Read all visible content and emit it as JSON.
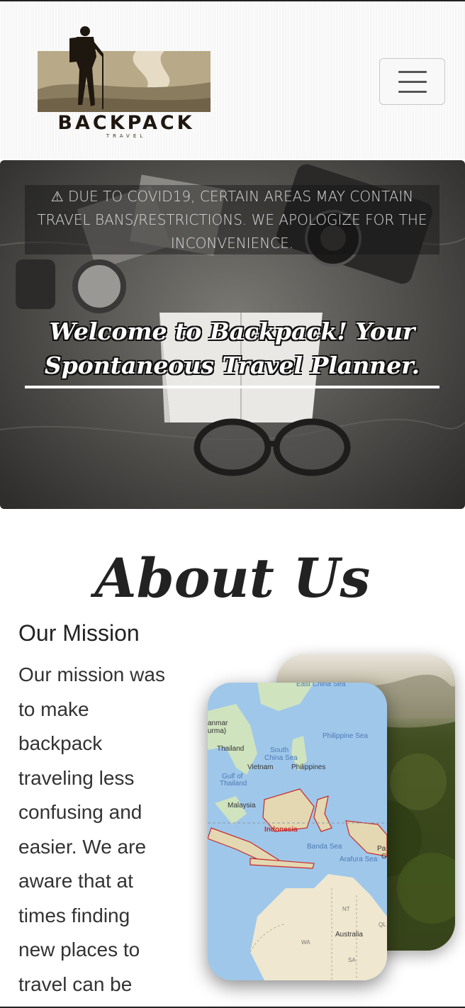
{
  "header": {
    "logo_text": "BACKPACK",
    "logo_subtext": "TRAVEL"
  },
  "hero": {
    "alert_icon": "⚠",
    "alert_text": "DUE TO COVID19, CERTAIN AREAS MAY CONTAIN TRAVEL BANS/RESTRICTIONS. WE APOLOGIZE FOR THE INCONVENIENCE.",
    "title_line1": "Welcome to Backpack! Your",
    "title_line2": "Spontaneous Travel Planner."
  },
  "about": {
    "title": "About Us",
    "mission_title": "Our Mission",
    "mission_text": "Our mission was to make backpack traveling less confusing and easier. We are aware that at times finding new places to travel can be"
  },
  "map": {
    "labels": {
      "east_china_sea": "East China Sea",
      "philippine_sea": "Philippine Sea",
      "myanmar": "anmar",
      "burma": "urma)",
      "thailand": "Thailand",
      "south_china_sea_1": "South",
      "south_china_sea_2": "China Sea",
      "vietnam": "Vietnam",
      "philippines": "Philippines",
      "gulf_1": "Gulf of",
      "gulf_2": "Thailand",
      "malaysia": "Malaysia",
      "indonesia": "Indonesia",
      "banda_sea": "Banda Sea",
      "arafura_sea": "Arafura Sea",
      "nt": "NT",
      "australia": "Australia",
      "wa": "WA",
      "sa": "SA",
      "ql": "QL",
      "pa": "Pa",
      "g": "G"
    }
  },
  "colors": {
    "accent_dark": "#222222",
    "logo_brown": "#8b7a5a",
    "map_water": "#9fc7ea",
    "map_land": "#cfe3bf"
  }
}
